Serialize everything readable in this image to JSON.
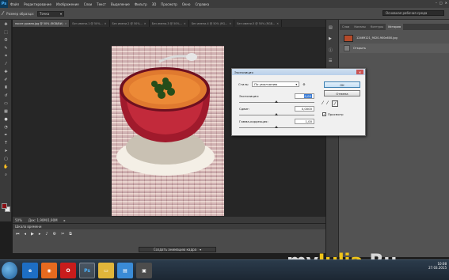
{
  "app": {
    "logo": "Ps",
    "menu": [
      "Файл",
      "Редактирование",
      "Изображение",
      "Слои",
      "Текст",
      "Выделение",
      "Фильтр",
      "3D",
      "Просмотр",
      "Окно",
      "Справка"
    ],
    "window_controls": [
      "–",
      "□",
      "✕"
    ]
  },
  "options": {
    "sample_size_label": "Размер образца:",
    "sample_size_value": "Точка",
    "workspace": "Основная рабочая среда"
  },
  "tabs": [
    {
      "label": "после уровня.jpg @ 50% (RGB/8#)",
      "active": true
    },
    {
      "label": "Без имени-1 @ 50%...",
      "active": false
    },
    {
      "label": "Без имени-2 @ 50%...",
      "active": false
    },
    {
      "label": "Без имени-3 @ 50%...",
      "active": false
    },
    {
      "label": "Без имени-4 @ 50% (RG...",
      "active": false
    },
    {
      "label": "Без имени-5 @ 50% (RGB...",
      "active": false
    }
  ],
  "status": {
    "zoom": "50%",
    "doc": "Док: 1,90М/1,90М"
  },
  "timeline": {
    "title": "Шкала времени",
    "create_button": "Создать анимацию кадра"
  },
  "panel": {
    "tabs": [
      "Слои",
      "Каналы",
      "Контуры",
      "История"
    ],
    "active_tab": "История",
    "history_snapshot": "12469121_9020-900x600.jpg",
    "history_open": "Открыть"
  },
  "dialog": {
    "title": "Экспозиция",
    "preset_label": "Стиль:",
    "preset_value": "По умолчанию",
    "exposure_label": "Экспозиция:",
    "exposure_value": "0,00",
    "offset_label": "Сдвиг:",
    "offset_value": "0,0000",
    "gamma_label": "Гамма-коррекция:",
    "gamma_value": "1,00",
    "ok_label": "OK",
    "cancel_label": "Отмена",
    "preview_label": "Просмотр",
    "preview_checked": true
  },
  "taskbar": {
    "tray_time": "10:08",
    "tray_date": "27.03.2015"
  },
  "watermark": {
    "part1": "my",
    "part2": "Julia",
    "part3": ".Ru"
  }
}
